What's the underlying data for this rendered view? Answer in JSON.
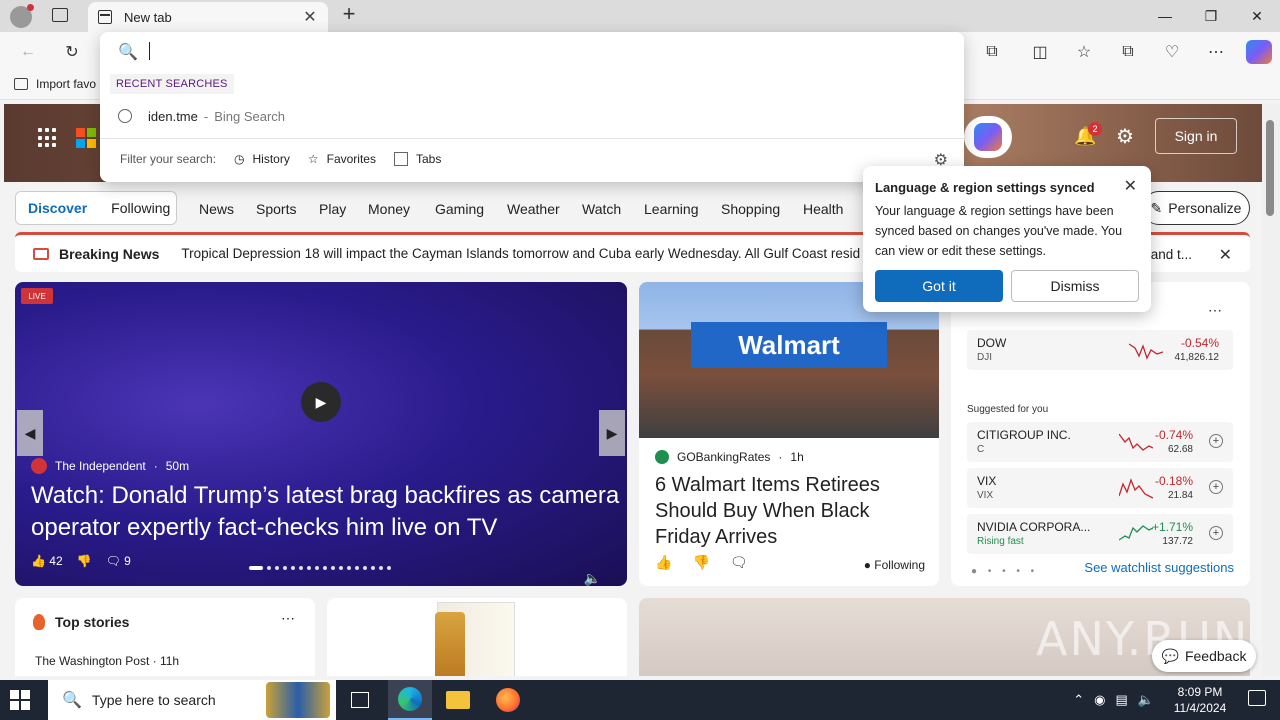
{
  "browser": {
    "tab_title": "New tab",
    "tab_close": "✕",
    "new_tab": "+",
    "favorites_bar_item": "Import favo"
  },
  "omnibox": {
    "value": "",
    "recent_label": "RECENT SEARCHES",
    "recent_query": "iden.tme",
    "recent_separator": "-",
    "recent_engine": "Bing Search",
    "filter_label": "Filter your search:",
    "filters": [
      "History",
      "Favorites",
      "Tabs"
    ]
  },
  "msn": {
    "notification_count": "2",
    "signin": "Sign in",
    "segments": [
      "Discover",
      "Following"
    ],
    "nav": [
      "News",
      "Sports",
      "Play",
      "Money",
      "Gaming",
      "Weather",
      "Watch",
      "Learning",
      "Shopping",
      "Health"
    ],
    "personalize": "Personalize",
    "breaking_title": "Breaking News",
    "breaking_text": "Tropical Depression 18 will impact the Cayman Islands tomorrow and Cuba early Wednesday. All Gulf Coast resid",
    "breaking_tail": "and t..."
  },
  "hero": {
    "live": "LIVE",
    "source": "The Independent",
    "age": "50m",
    "title": "Watch: Donald Trump’s latest brag backfires as camera operator expertly fact-checks him live on TV",
    "likes": "42",
    "comments": "9"
  },
  "news": {
    "sign": "Walmart",
    "source": "GOBankingRates",
    "age": "1h",
    "title": "6 Walmart Items Retirees Should Buy When Black Friday Arrives",
    "following": "Following"
  },
  "watchlist": {
    "stocks": [
      {
        "name": "DOW",
        "symbol": "DJI",
        "change": "-0.54%",
        "value": "41,826.12"
      }
    ],
    "suggested_label": "Suggested for you",
    "suggested": [
      {
        "name": "CITIGROUP INC.",
        "symbol": "C",
        "change": "-0.74%",
        "value": "62.68"
      },
      {
        "name": "VIX",
        "symbol": "VIX",
        "change": "-0.18%",
        "value": "21.84"
      },
      {
        "name": "NVIDIA CORPORA...",
        "symbol": "Rising fast",
        "change": "+1.71%",
        "value": "137.72"
      }
    ],
    "more_link": "See watchlist suggestions"
  },
  "top_stories": {
    "title": "Top stories",
    "source": "The Washington Post · 11h"
  },
  "popup": {
    "title": "Language & region settings synced",
    "body": "Your language & region settings have been synced based on changes you've made. You can view or edit these settings.",
    "primary": "Got it",
    "secondary": "Dismiss"
  },
  "feedback": "Feedback",
  "watermark": "ANY.RUN",
  "taskbar": {
    "search_placeholder": "Type here to search",
    "time": "8:09 PM",
    "date": "11/4/2024"
  },
  "colors": {
    "accent": "#0f6cbd",
    "breaking": "#d74b3f",
    "negative": "#c4262e",
    "positive": "#1d8f4f"
  }
}
